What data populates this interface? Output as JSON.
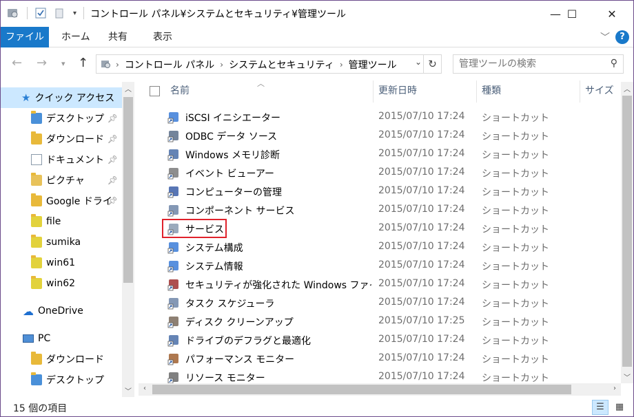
{
  "window": {
    "title": "コントロール パネル¥システムとセキュリティ¥管理ツール",
    "minimize_glyph": "—",
    "maximize_glyph": "☐",
    "close_glyph": "✕"
  },
  "ribbon": {
    "tabs": [
      "ファイル",
      "ホーム",
      "共有",
      "表示"
    ],
    "help_glyph": "?"
  },
  "address": {
    "crumbs": [
      "コントロール パネル",
      "システムとセキュリティ",
      "管理ツール"
    ],
    "search_placeholder": "管理ツールの検索"
  },
  "nav": {
    "quick_access": "クイック アクセス",
    "items": [
      {
        "label": "デスクトップ",
        "pinned": true
      },
      {
        "label": "ダウンロード",
        "pinned": true
      },
      {
        "label": "ドキュメント",
        "pinned": true
      },
      {
        "label": "ピクチャ",
        "pinned": true
      },
      {
        "label": "Google ドライブ",
        "pinned": true
      },
      {
        "label": "file",
        "pinned": false
      },
      {
        "label": "sumika",
        "pinned": false
      },
      {
        "label": "win61",
        "pinned": false
      },
      {
        "label": "win62",
        "pinned": false
      }
    ],
    "onedrive": "OneDrive",
    "pc": "PC",
    "pc_items": [
      "ダウンロード",
      "デスクトップ"
    ]
  },
  "columns": {
    "name": "名前",
    "date": "更新日時",
    "type": "種類",
    "size": "サイズ"
  },
  "files": [
    {
      "name": "iSCSI イニシエーター",
      "date": "2015/07/10 17:24",
      "type": "ショートカット"
    },
    {
      "name": "ODBC データ ソース",
      "date": "2015/07/10 17:24",
      "type": "ショートカット"
    },
    {
      "name": "Windows メモリ診断",
      "date": "2015/07/10 17:24",
      "type": "ショートカット"
    },
    {
      "name": "イベント ビューアー",
      "date": "2015/07/10 17:24",
      "type": "ショートカット"
    },
    {
      "name": "コンピューターの管理",
      "date": "2015/07/10 17:24",
      "type": "ショートカット"
    },
    {
      "name": "コンポーネント サービス",
      "date": "2015/07/10 17:24",
      "type": "ショートカット"
    },
    {
      "name": "サービス",
      "date": "2015/07/10 17:24",
      "type": "ショートカット"
    },
    {
      "name": "システム構成",
      "date": "2015/07/10 17:24",
      "type": "ショートカット"
    },
    {
      "name": "システム情報",
      "date": "2015/07/10 17:24",
      "type": "ショートカット"
    },
    {
      "name": "セキュリティが強化された Windows ファイア...",
      "date": "2015/07/10 17:24",
      "type": "ショートカット"
    },
    {
      "name": "タスク スケジューラ",
      "date": "2015/07/10 17:24",
      "type": "ショートカット"
    },
    {
      "name": "ディスク クリーンアップ",
      "date": "2015/07/10 17:25",
      "type": "ショートカット"
    },
    {
      "name": "ドライブのデフラグと最適化",
      "date": "2015/07/10 17:24",
      "type": "ショートカット"
    },
    {
      "name": "パフォーマンス モニター",
      "date": "2015/07/10 17:24",
      "type": "ショートカット"
    },
    {
      "name": "リソース モニター",
      "date": "2015/07/10 17:24",
      "type": "ショートカット"
    }
  ],
  "status": {
    "count_text": "15 個の項目"
  },
  "colors": {
    "accent": "#1979ca",
    "selection": "#cce8ff",
    "highlight": "#e0212b"
  }
}
